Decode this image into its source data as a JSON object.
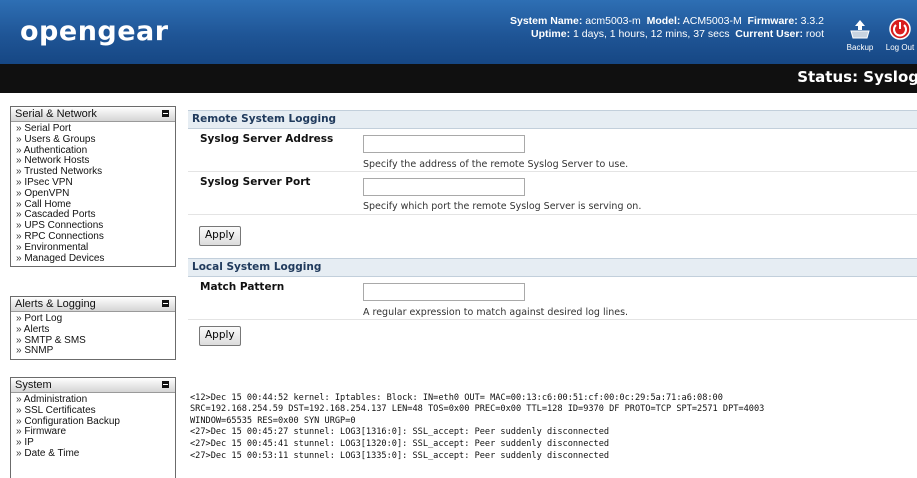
{
  "header": {
    "logo": "opengear",
    "system_name_label": "System Name:",
    "system_name": "acm5003-m",
    "model_label": "Model:",
    "model": "ACM5003-M",
    "firmware_label": "Firmware:",
    "firmware": "3.3.2",
    "uptime_label": "Uptime:",
    "uptime": "1 days, 1 hours, 12 mins, 37 secs",
    "current_user_label": "Current User:",
    "current_user": "root",
    "backup_label": "Backup",
    "logout_label": "Log Out"
  },
  "page_title": "Status: Syslog",
  "sidebar": {
    "serial_network": {
      "title": "Serial & Network",
      "items": [
        "Serial Port",
        "Users & Groups",
        "Authentication",
        "Network Hosts",
        "Trusted Networks",
        "IPsec VPN",
        "OpenVPN",
        "Call Home",
        "Cascaded Ports",
        "UPS Connections",
        "RPC Connections",
        "Environmental",
        "Managed Devices"
      ]
    },
    "alerts_logging": {
      "title": "Alerts & Logging",
      "items": [
        "Port Log",
        "Alerts",
        "SMTP & SMS",
        "SNMP"
      ]
    },
    "system": {
      "title": "System",
      "items": [
        "Administration",
        "SSL Certificates",
        "Configuration Backup",
        "Firmware",
        "IP",
        "Date & Time"
      ]
    }
  },
  "remote": {
    "title": "Remote System Logging",
    "address_label": "Syslog Server Address",
    "address_value": "",
    "address_hint": "Specify the address of the remote Syslog Server to use.",
    "port_label": "Syslog Server Port",
    "port_value": "",
    "port_hint": "Specify which port the remote Syslog Server is serving on.",
    "apply_label": "Apply"
  },
  "local": {
    "title": "Local System Logging",
    "match_label": "Match Pattern",
    "match_value": "",
    "match_hint": "A regular expression to match against desired log lines.",
    "apply_label": "Apply"
  },
  "log_lines": [
    "<12>Dec 15 00:44:52 kernel: Iptables: Block: IN=eth0 OUT= MAC=00:13:c6:00:51:cf:00:0c:29:5a:71:a6:08:00",
    "SRC=192.168.254.59 DST=192.168.254.137 LEN=48 TOS=0x00 PREC=0x00 TTL=128 ID=9370 DF PROTO=TCP SPT=2571 DPT=4003",
    "WINDOW=65535 RES=0x00 SYN URGP=0",
    "<27>Dec 15 00:45:27 stunnel: LOG3[1316:0]: SSL_accept: Peer suddenly disconnected",
    "<27>Dec 15 00:45:41 stunnel: LOG3[1320:0]: SSL_accept: Peer suddenly disconnected",
    "<27>Dec 15 00:53:11 stunnel: LOG3[1335:0]: SSL_accept: Peer suddenly disconnected"
  ]
}
